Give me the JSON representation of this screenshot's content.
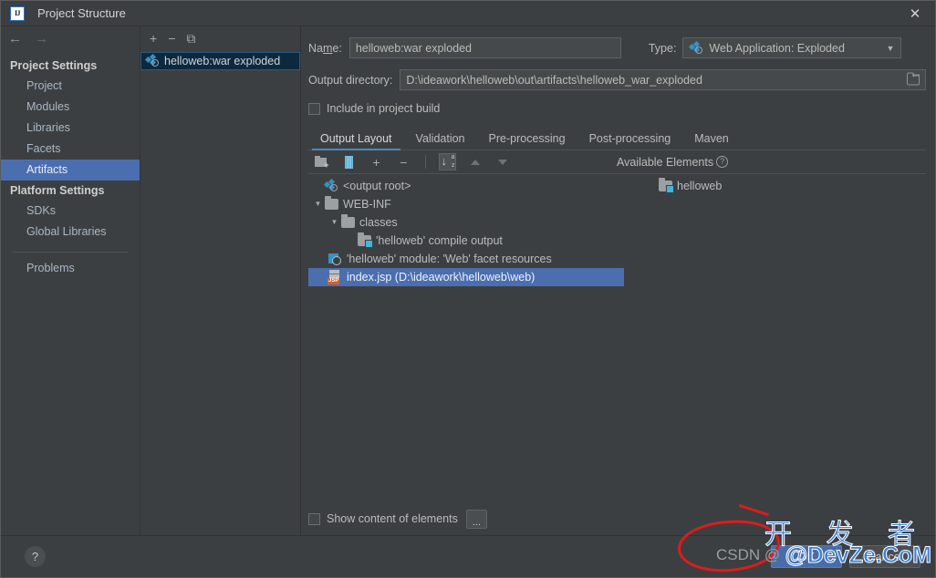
{
  "window": {
    "title": "Project Structure",
    "app_icon": "intellij-idea-icon",
    "close_label": "✕"
  },
  "nav": {
    "back": "←",
    "forward": "→"
  },
  "sidebar": {
    "groups": [
      {
        "header": "Project Settings",
        "items": [
          {
            "label": "Project",
            "selected": false
          },
          {
            "label": "Modules",
            "selected": false
          },
          {
            "label": "Libraries",
            "selected": false
          },
          {
            "label": "Facets",
            "selected": false
          },
          {
            "label": "Artifacts",
            "selected": true
          }
        ]
      },
      {
        "header": "Platform Settings",
        "items": [
          {
            "label": "SDKs",
            "selected": false
          },
          {
            "label": "Global Libraries",
            "selected": false
          }
        ]
      }
    ],
    "problems": {
      "label": "Problems",
      "selected": false
    }
  },
  "artifacts": {
    "toolbar": [
      {
        "name": "add-artifact-button",
        "glyph": "+"
      },
      {
        "name": "remove-artifact-button",
        "glyph": "−"
      },
      {
        "name": "copy-artifact-button",
        "glyph": "⧉"
      }
    ],
    "items": [
      {
        "label": "helloweb:war exploded",
        "icon": "artifact-icon",
        "selected": true
      }
    ]
  },
  "details": {
    "name_label": "Name:",
    "name_value": "helloweb:war exploded",
    "name_placeholder": "",
    "type_label": "Type:",
    "type_value": "Web Application: Exploded",
    "type_icon": "artifact-icon",
    "output_dir_label": "Output directory:",
    "output_dir_value": "D:\\ideawork\\helloweb\\out\\artifacts\\helloweb_war_exploded",
    "output_dir_placeholder": "",
    "browse_icon": "folder-icon",
    "include_in_build_label": "Include in project build",
    "include_in_build_checked": false,
    "tabs": [
      {
        "label": "Output Layout",
        "active": true
      },
      {
        "label": "Validation",
        "active": false
      },
      {
        "label": "Pre-processing",
        "active": false
      },
      {
        "label": "Post-processing",
        "active": false
      },
      {
        "label": "Maven",
        "active": false
      }
    ],
    "layout_toolbar": [
      {
        "name": "create-directory-button",
        "icon": "new-folder-icon"
      },
      {
        "name": "create-archive-button",
        "icon": "jar-archive-icon"
      },
      {
        "name": "add-copy-of-button",
        "icon": "plus-icon",
        "glyph": "+"
      },
      {
        "name": "remove-element-button",
        "icon": "minus-icon",
        "glyph": "−"
      },
      {
        "name": "sort-elements-button",
        "icon": "sort-alphabetically-icon",
        "toggled": true
      },
      {
        "name": "move-up-button",
        "icon": "triangle-up-icon"
      },
      {
        "name": "move-down-button",
        "icon": "triangle-down-icon"
      }
    ],
    "available_elements_label": "Available Elements",
    "available_elements_help": "?",
    "tree": [
      {
        "label": "<output root>",
        "icon": "artifact-icon",
        "indent": 0,
        "twisty": "",
        "selected": false
      },
      {
        "label": "WEB-INF",
        "icon": "folder-icon",
        "indent": 1,
        "twisty": "expanded",
        "selected": false
      },
      {
        "label": "classes",
        "icon": "folder-icon",
        "indent": 2,
        "twisty": "expanded",
        "selected": false
      },
      {
        "label": "'helloweb' compile output",
        "icon": "module-output-icon",
        "indent": 3,
        "twisty": "",
        "selected": false
      },
      {
        "label": "'helloweb' module: 'Web' facet resources",
        "icon": "facet-resources-icon",
        "indent": 1,
        "twisty": "",
        "selected": false
      },
      {
        "label": "index.jsp (D:\\ideawork\\helloweb\\web)",
        "icon": "jsp-file-icon",
        "indent": 1,
        "twisty": "",
        "selected": true
      }
    ],
    "available_tree": [
      {
        "label": "helloweb",
        "icon": "module-output-icon",
        "indent": 1,
        "selected": false
      }
    ],
    "show_content_label": "Show content of elements",
    "show_content_checked": false,
    "ellipsis_button_label": "..."
  },
  "footer": {
    "help_label": "?",
    "buttons": [
      {
        "label": "OK",
        "style": "primary"
      },
      {
        "label": "Cancel",
        "style": "secondary"
      }
    ]
  },
  "watermark": {
    "cjk": "开 发 者",
    "latin": "@DevZe.CoM",
    "csdn": "CSDN @"
  },
  "colors": {
    "window_bg": "#3c3f41",
    "selection_focused": "#4b6eaf",
    "selection_unfocused": "#0d293e",
    "accent_tab": "#4a88c7",
    "icon_blue": "#3592c4",
    "watermark_red": "#e01b1b",
    "watermark_blue": "#3a7fd5"
  }
}
